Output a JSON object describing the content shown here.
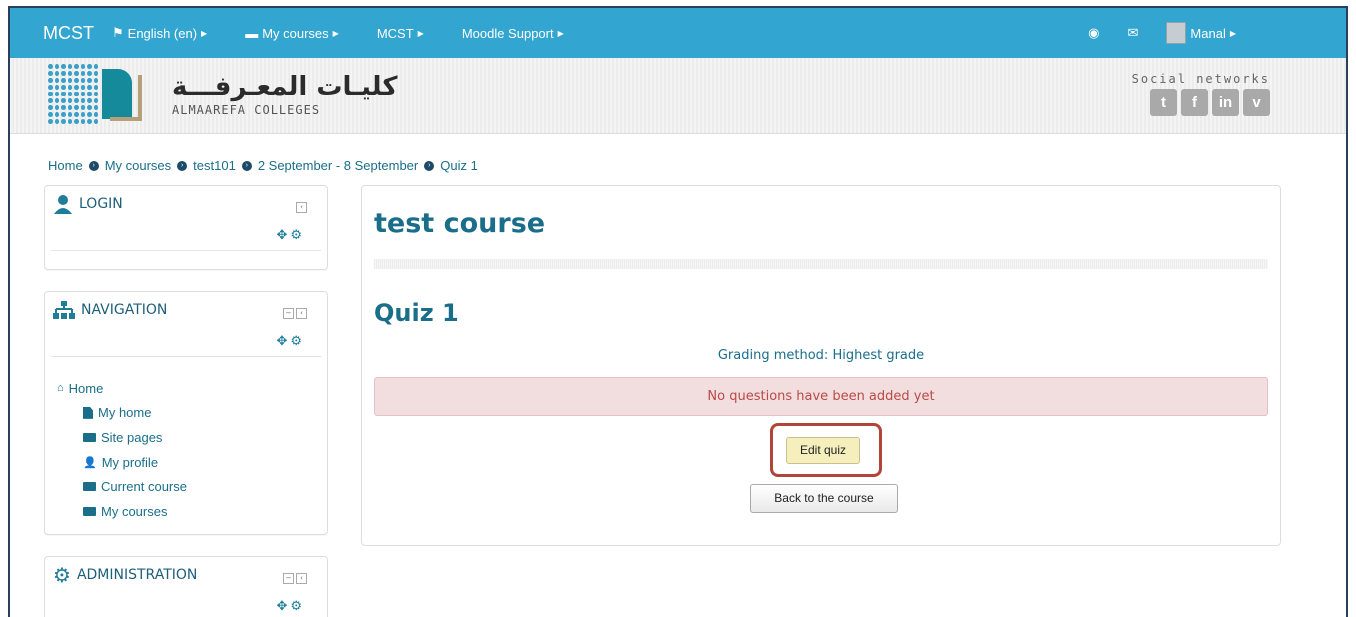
{
  "colors": {
    "navbar": "#32a6d0",
    "accent": "#1a6e8a",
    "alert_bg": "#f2dede",
    "alert_text": "#b94a48",
    "highlight": "#b2443a"
  },
  "navbar": {
    "brand": "MCST",
    "language": "English (en)",
    "my_courses": "My courses",
    "mcst": "MCST",
    "support": "Moodle Support",
    "user": "Manal",
    "icons": [
      "flag-icon",
      "briefcase-icon",
      "notification-icon",
      "message-icon",
      "user-avatar"
    ]
  },
  "header": {
    "logo_arabic": "كليـات المعـرفـــة",
    "logo_english": "ALMAAREFA COLLEGES",
    "social_label": "Social networks",
    "social_icons": [
      "twitter-icon",
      "facebook-icon",
      "linkedin-icon",
      "vimeo-icon"
    ]
  },
  "breadcrumb": [
    "Home",
    "My courses",
    "test101",
    "2 September - 8 September",
    "Quiz 1"
  ],
  "blocks": {
    "login": {
      "title": "LOGIN"
    },
    "navigation": {
      "title": "NAVIGATION",
      "items": [
        "Home",
        "My home",
        "Site pages",
        "My profile",
        "Current course",
        "My courses"
      ]
    },
    "administration": {
      "title": "ADMINISTRATION"
    }
  },
  "main": {
    "course_title": "test course",
    "quiz_title": "Quiz 1",
    "grading": "Grading method: Highest grade",
    "alert": "No questions have been added yet",
    "edit_button": "Edit quiz",
    "back_button": "Back to the course"
  }
}
